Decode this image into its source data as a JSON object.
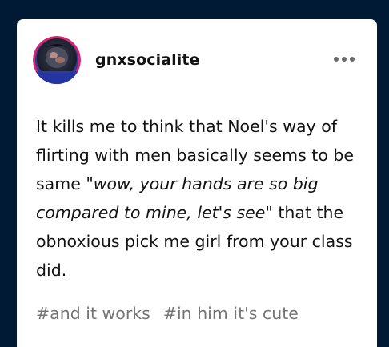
{
  "post": {
    "username": "gnxsocialite",
    "body": {
      "text_before": "It kills me to think that Noel's way of flirting with men basically seems to be same ",
      "emphasis": "\"wow, your hands are so big compared to mine, let's see\"",
      "text_after": " that the obnoxious pick me girl from your class did."
    },
    "tags": [
      "#and it works",
      "#in him it's cute"
    ],
    "more_icon": "more-horizontal-icon"
  },
  "colors": {
    "page_background": "#001935",
    "card_background": "#ffffff",
    "text": "#121212",
    "tag_text": "#757575",
    "avatar_ring": "#d6246e"
  }
}
